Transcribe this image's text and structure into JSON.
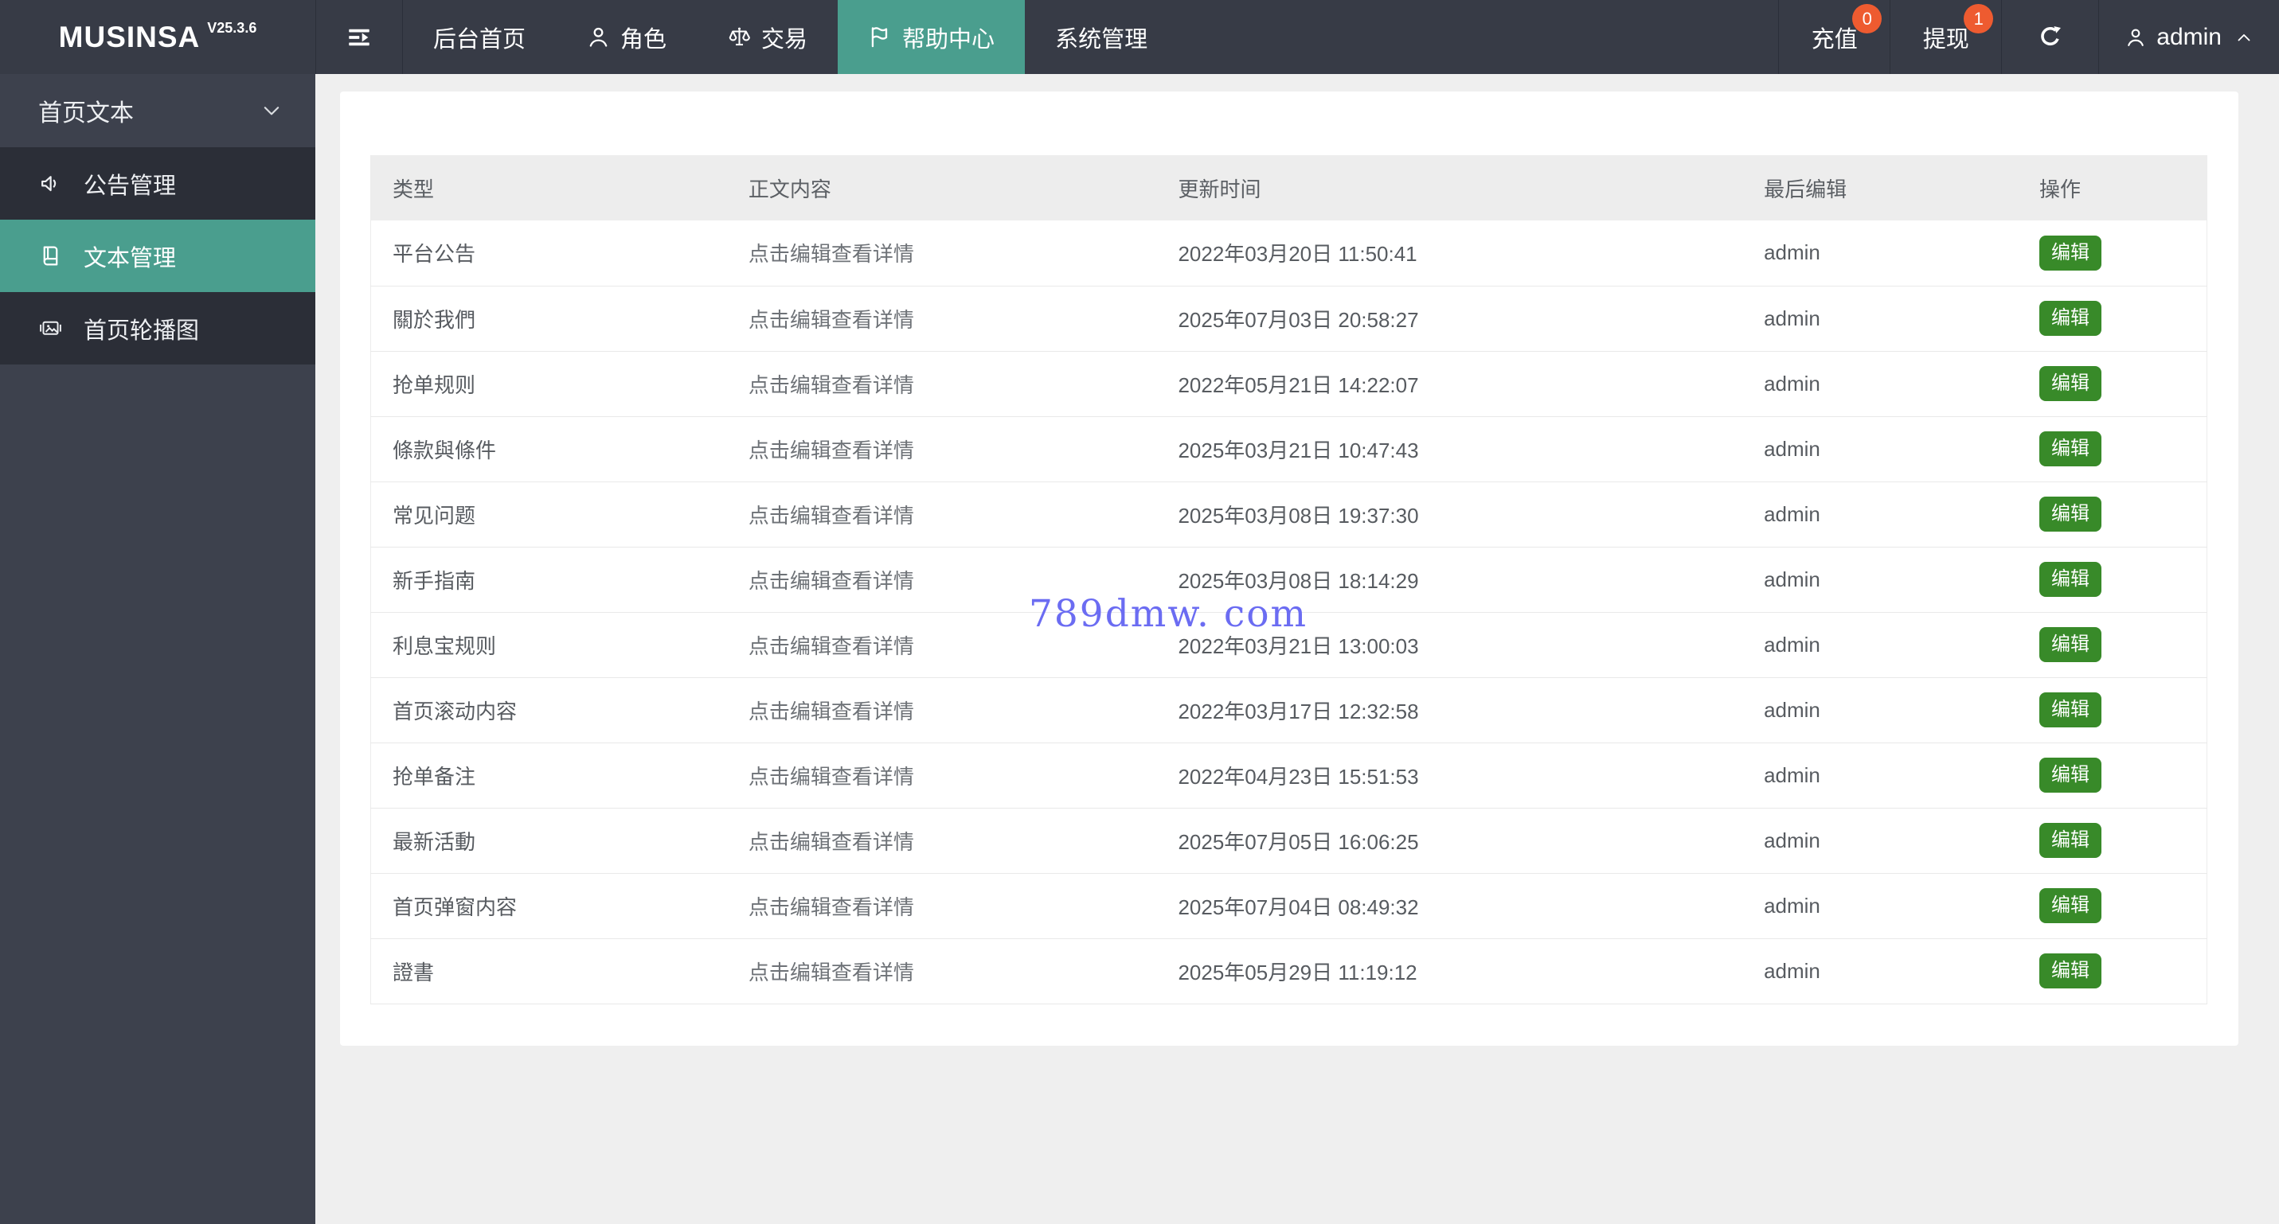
{
  "topbar": {
    "logo": "MUSINSA",
    "version": "V25.3.6",
    "nav": [
      {
        "name": "dashboard",
        "label": "后台首页",
        "active": false
      },
      {
        "name": "roles",
        "label": "角色",
        "icon": "user",
        "active": false
      },
      {
        "name": "trade",
        "label": "交易",
        "icon": "scales",
        "active": false
      },
      {
        "name": "help-center",
        "label": "帮助中心",
        "icon": "flag",
        "active": true
      },
      {
        "name": "system",
        "label": "系统管理",
        "active": false
      }
    ],
    "recharge": {
      "label": "充值",
      "badge": "0"
    },
    "withdraw": {
      "label": "提现",
      "badge": "1"
    },
    "user": {
      "name": "admin"
    }
  },
  "sidebar": {
    "section_title": "首页文本",
    "items": [
      {
        "name": "announcement-management",
        "label": "公告管理",
        "icon": "speaker",
        "active": false
      },
      {
        "name": "text-management",
        "label": "文本管理",
        "icon": "book",
        "active": true
      },
      {
        "name": "home-carousel",
        "label": "首页轮播图",
        "icon": "image",
        "active": false
      }
    ]
  },
  "table": {
    "columns": [
      "类型",
      "正文内容",
      "更新时间",
      "最后编辑",
      "操作"
    ],
    "edit_label": "编辑",
    "rows": [
      {
        "type": "平台公告",
        "content": "点击编辑查看详情",
        "updated": "2022年03月20日 11:50:41",
        "editor": "admin"
      },
      {
        "type": "關於我們",
        "content": "点击编辑查看详情",
        "updated": "2025年07月03日 20:58:27",
        "editor": "admin"
      },
      {
        "type": "抢单规则",
        "content": "点击编辑查看详情",
        "updated": "2022年05月21日 14:22:07",
        "editor": "admin"
      },
      {
        "type": "條款與條件",
        "content": "点击编辑查看详情",
        "updated": "2025年03月21日 10:47:43",
        "editor": "admin"
      },
      {
        "type": "常见问题",
        "content": "点击编辑查看详情",
        "updated": "2025年03月08日 19:37:30",
        "editor": "admin"
      },
      {
        "type": "新手指南",
        "content": "点击编辑查看详情",
        "updated": "2025年03月08日 18:14:29",
        "editor": "admin"
      },
      {
        "type": "利息宝规则",
        "content": "点击编辑查看详情",
        "updated": "2022年03月21日 13:00:03",
        "editor": "admin"
      },
      {
        "type": "首页滚动内容",
        "content": "点击编辑查看详情",
        "updated": "2022年03月17日 12:32:58",
        "editor": "admin"
      },
      {
        "type": "抢单备注",
        "content": "点击编辑查看详情",
        "updated": "2022年04月23日 15:51:53",
        "editor": "admin"
      },
      {
        "type": "最新活動",
        "content": "点击编辑查看详情",
        "updated": "2025年07月05日 16:06:25",
        "editor": "admin"
      },
      {
        "type": "首页弹窗内容",
        "content": "点击编辑查看详情",
        "updated": "2025年07月04日 08:49:32",
        "editor": "admin"
      },
      {
        "type": "證書",
        "content": "点击编辑查看详情",
        "updated": "2025年05月29日 11:19:12",
        "editor": "admin"
      }
    ]
  },
  "watermark": "789dmw. com",
  "colors": {
    "accent_teal": "#4a9e8e",
    "edit_button_green": "#388a29",
    "badge_orange": "#ee5b30",
    "watermark_blue": "#6b6cf2",
    "topbar_dark": "#373b46",
    "sidebar_dark": "#3d414d",
    "submenu_dark": "#2b2e37"
  }
}
